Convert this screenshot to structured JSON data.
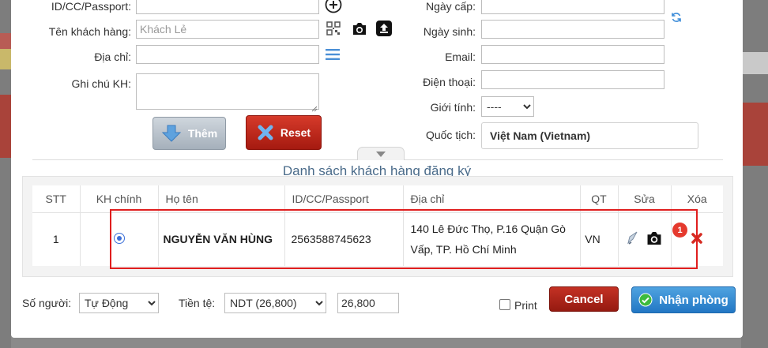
{
  "form_left": {
    "id_label": "ID/CC/Passport:",
    "id_value": "",
    "name_label": "Tên khách hàng:",
    "name_placeholder": "Khách Lẻ",
    "address_label": "Địa chỉ:",
    "address_value": "",
    "note_label": "Ghi chú KH:",
    "note_value": ""
  },
  "form_right": {
    "issue_date_label": "Ngày cấp:",
    "issue_date_value": "",
    "birth_label": "Ngày sinh:",
    "birth_value": "",
    "email_label": "Email:",
    "email_value": "",
    "phone_label": "Điện thoại:",
    "phone_value": "",
    "gender_label": "Giới tính:",
    "gender_selected": "----",
    "nationality_label": "Quốc tịch:",
    "nationality_value": "Việt Nam (Vietnam)"
  },
  "buttons": {
    "add_label": "Thêm",
    "reset_label": "Reset",
    "cancel_label": "Cancel",
    "checkin_label": "Nhận phòng"
  },
  "section_title": "Danh sách khách hàng đăng ký",
  "table": {
    "headers": [
      "STT",
      "KH chính",
      "Họ tên",
      "ID/CC/Passport",
      "Địa chỉ",
      "QT",
      "Sửa",
      "Xóa"
    ],
    "rows": [
      {
        "stt": "1",
        "main": true,
        "name": "NGUYỄN VĂN HÙNG",
        "id": "2563588745623",
        "address": "140 Lê Đức Thọ, P.16 Quận Gò Vấp, TP. Hồ Chí Minh",
        "country": "VN",
        "photo_count": "1"
      }
    ]
  },
  "footer": {
    "people_label": "Số người:",
    "people_selected": "Tự Động",
    "currency_label": "Tiền tệ:",
    "currency_selected": "NDT (26,800)",
    "amount_value": "26,800",
    "print_label": "Print",
    "print_checked": false
  },
  "icons": [
    "plus-circle-icon",
    "qr-code-icon",
    "camera-icon",
    "upload-icon",
    "menu-lines-icon",
    "sync-icon",
    "download-arrow-icon",
    "close-x-icon",
    "chevron-down-icon",
    "edit-pencil-icon",
    "delete-x-icon",
    "check-circle-icon"
  ],
  "colors": {
    "accent_blue": "#2277c4",
    "danger_red": "#b3231a",
    "highlight_red": "#e01e1e",
    "title_blue": "#4a6b8a",
    "link_blue": "#3b8bd8"
  }
}
